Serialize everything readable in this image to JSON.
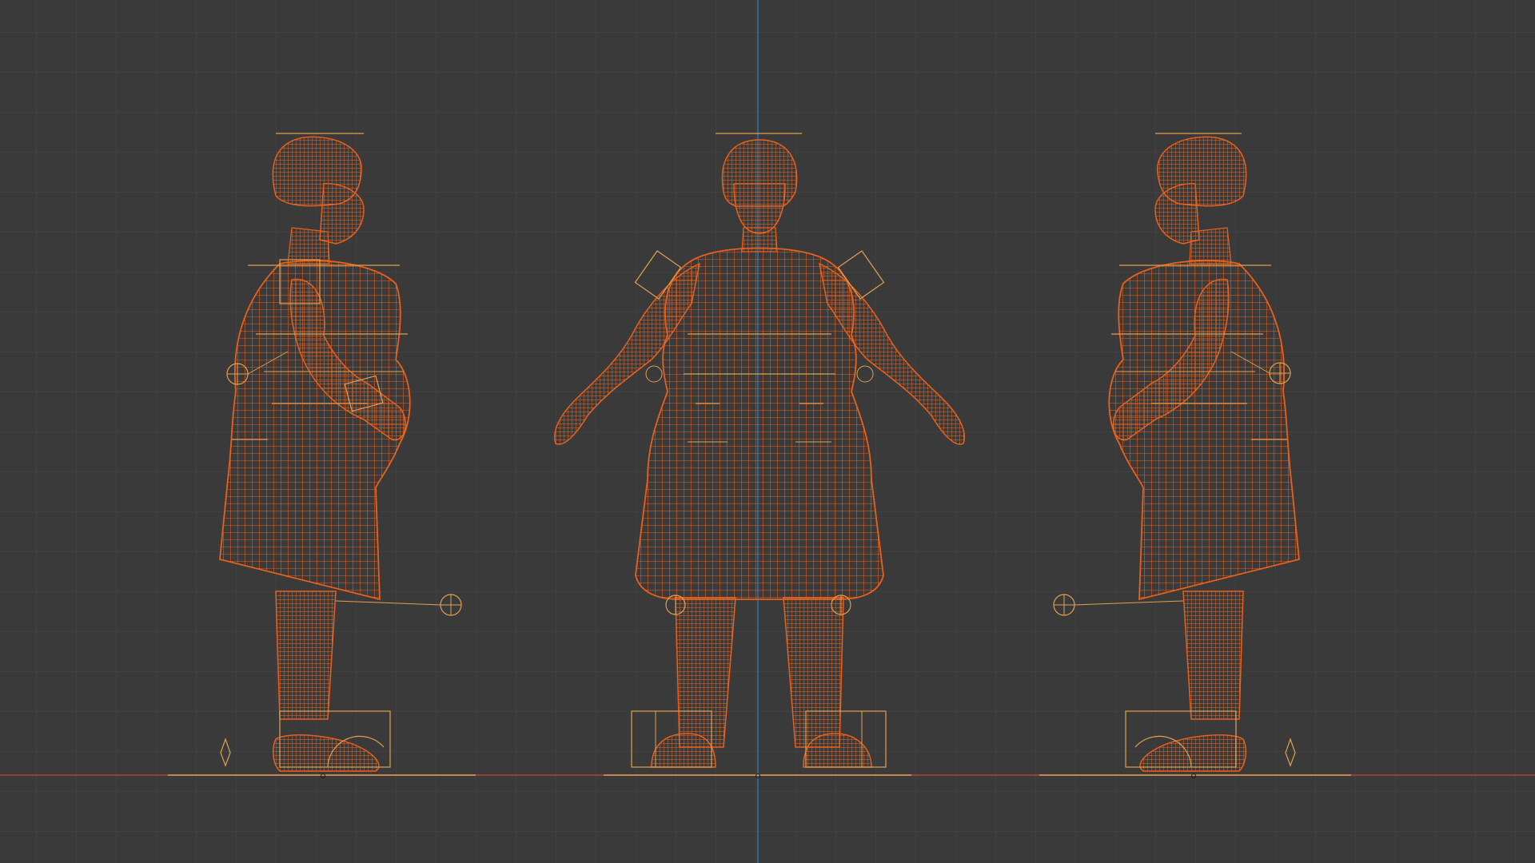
{
  "viewport": {
    "background": "#3a3a3a",
    "grid_color": "#474747",
    "x_axis_color": "#b0413e",
    "y_axis_color": "#3a6ea5",
    "wire_color": "#e8601c",
    "rig_color": "#e0a050"
  },
  "figures": [
    {
      "view": "side-right",
      "icon": "mesh-wireframe-icon"
    },
    {
      "view": "front",
      "icon": "mesh-wireframe-icon"
    },
    {
      "view": "side-left",
      "icon": "mesh-wireframe-icon"
    }
  ]
}
